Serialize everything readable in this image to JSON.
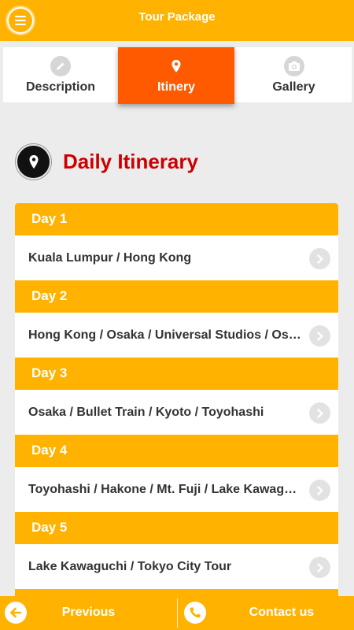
{
  "header": {
    "title": "Tour Package"
  },
  "tabs": [
    {
      "label": "Description",
      "icon": "pencil-icon"
    },
    {
      "label": "Itinery",
      "icon": "map-pin-icon"
    },
    {
      "label": "Gallery",
      "icon": "camera-icon"
    }
  ],
  "section": {
    "title": "Daily Itinerary",
    "icon": "map-pin-icon"
  },
  "days": [
    {
      "label": "Day 1",
      "route": "Kuala Lumpur / Hong Kong"
    },
    {
      "label": "Day 2",
      "route": "Hong Kong / Osaka / Universal Studios / Osaka"
    },
    {
      "label": "Day 3",
      "route": "Osaka / Bullet Train / Kyoto / Toyohashi"
    },
    {
      "label": "Day 4",
      "route": "Toyohashi / Hakone / Mt. Fuji / Lake Kawaguchi"
    },
    {
      "label": "Day 5",
      "route": "Lake Kawaguchi / Tokyo City Tour"
    }
  ],
  "footer": {
    "previous_label": "Previous",
    "contact_label": "Contact us"
  },
  "colors": {
    "accent": "#ffb300",
    "active_tab": "#ff5a00",
    "heading": "#cc0000"
  }
}
